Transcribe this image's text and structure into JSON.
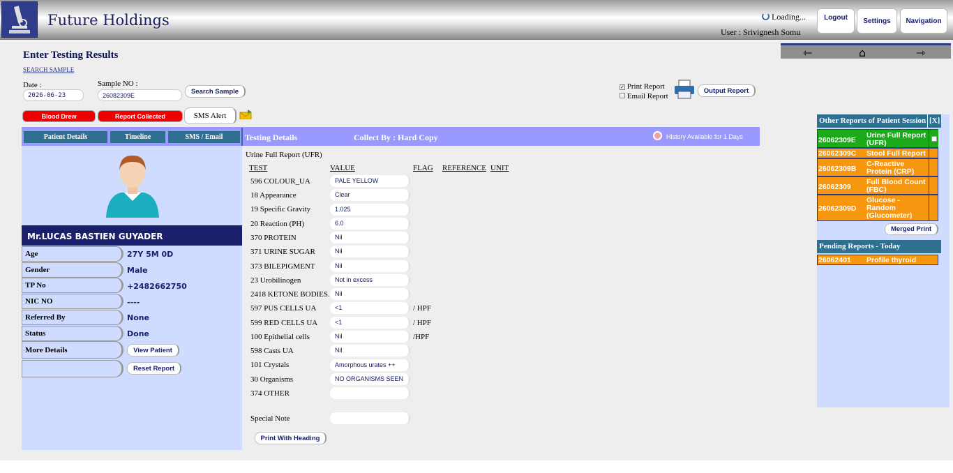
{
  "header": {
    "app_title": "Future Holdings",
    "loading_text": "Loading...",
    "user_text": "User : Srivignesh Somu",
    "logout_label": "Logout",
    "settings_label": "Settings",
    "navigation_label": "Navigation"
  },
  "page": {
    "title": "Enter Testing Results",
    "search_sample_link": "SEARCH SAMPLE",
    "date_label": "Date :",
    "date_value": "2026-06-23",
    "sample_no_label": "Sample NO :",
    "sample_no_value": "26082309E",
    "search_sample_button": "Search Sample",
    "print_report_label": "Print Report",
    "print_report_checked": true,
    "email_report_label": "Email Report",
    "email_report_checked": false,
    "output_report_button": "Output Report",
    "blood_drew_button": "Blood Drew",
    "report_collected_button": "Report Collected",
    "sms_alert_button": "SMS Alert"
  },
  "tabs": {
    "patient_details": "Patient Details",
    "timeline": "Timeline",
    "sms_email": "SMS / Email",
    "testing_details": "Testing Details",
    "collect_by": "Collect By : Hard Copy",
    "history": "History Available for 1 Days"
  },
  "patient": {
    "name": "Mr.LUCAS BASTIEN GUYADER",
    "rows": [
      {
        "label": "Age",
        "value": "27Y 5M 0D"
      },
      {
        "label": "Gender",
        "value": "Male"
      },
      {
        "label": "TP No",
        "value": "+2482662750"
      },
      {
        "label": "NIC NO",
        "value": "----"
      },
      {
        "label": "Referred By",
        "value": "None"
      },
      {
        "label": "Status",
        "value": "Done"
      },
      {
        "label": "More Details",
        "value": ""
      }
    ],
    "view_patient_button": "View Patient",
    "reset_report_button": "Reset Report"
  },
  "results": {
    "report_title": "Urine Full Report (UFR)",
    "columns": [
      "TEST",
      "VALUE",
      "FLAG",
      "REFERENCE",
      "UNIT"
    ],
    "tests": [
      {
        "name": "596 COLOUR_UA",
        "value": "PALE YELLOW",
        "unit": ""
      },
      {
        "name": "18 Appearance",
        "value": "Clear",
        "unit": ""
      },
      {
        "name": "19 Specific Gravity",
        "value": "1.025",
        "unit": ""
      },
      {
        "name": "20 Reaction (PH)",
        "value": "6.0",
        "unit": ""
      },
      {
        "name": "370 PROTEIN",
        "value": "Nil",
        "unit": ""
      },
      {
        "name": "371 URINE SUGAR",
        "value": "Nil",
        "unit": ""
      },
      {
        "name": "373 BILEPIGMENT",
        "value": "Nil",
        "unit": ""
      },
      {
        "name": "23 Urobilinogen",
        "value": "Not in excess",
        "unit": ""
      },
      {
        "name": "2418 KETONE BODIES.",
        "value": "Nil",
        "unit": ""
      },
      {
        "name": "597 PUS CELLS UA",
        "value": "<1",
        "unit": "/ HPF"
      },
      {
        "name": "599 RED CELLS UA",
        "value": "<1",
        "unit": "/ HPF"
      },
      {
        "name": "100 Epithelial cells",
        "value": "Nil",
        "unit": "/HPF"
      },
      {
        "name": "598 Casts UA",
        "value": "Nil",
        "unit": ""
      },
      {
        "name": "101 Crystals",
        "value": "Amorphous urates ++",
        "unit": ""
      },
      {
        "name": "30 Organisms",
        "value": "NO ORGANISMS SEEN",
        "unit": ""
      },
      {
        "name": "374 OTHER",
        "value": "",
        "unit": ""
      }
    ],
    "special_note_label": "Special Note",
    "special_note_value": "",
    "print_with_heading_button": "Print With Heading"
  },
  "side": {
    "other_reports_title": "Other Reports of Patient Session",
    "close_label": "[X]",
    "other_reports": [
      {
        "id": "26062309E",
        "name": "Urine Full Report (UFR)",
        "color": "#1aaa1a"
      },
      {
        "id": "26062309C",
        "name": "Stool Full Report",
        "color": "#f7960f"
      },
      {
        "id": "26062309B",
        "name": "C-Reactive Protein (CRP)",
        "color": "#f7960f"
      },
      {
        "id": "26062309",
        "name": "Full Blood Count (FBC)",
        "color": "#f7960f"
      },
      {
        "id": "26062309D",
        "name": "Glucose - Random (Glucometer)",
        "color": "#f7960f"
      }
    ],
    "merged_print_button": "Merged Print",
    "pending_title": "Pending Reports - Today",
    "pending": [
      {
        "id": "26062401",
        "name": "Profile thyroid"
      }
    ]
  }
}
